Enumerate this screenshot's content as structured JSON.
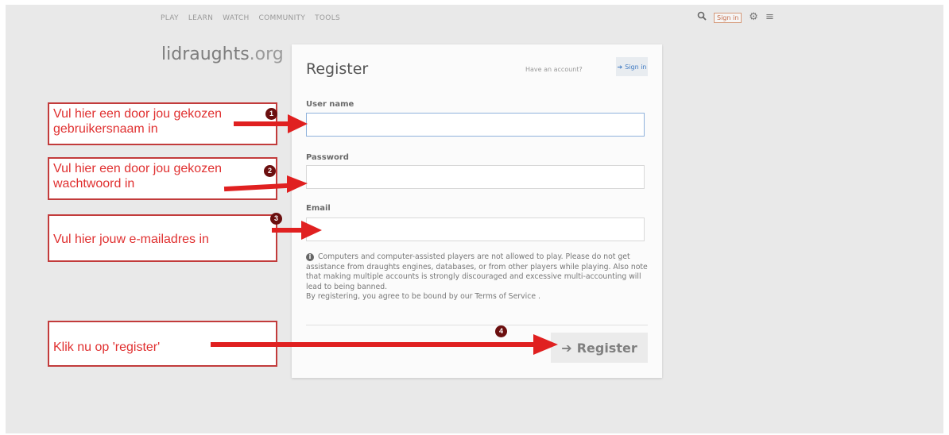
{
  "nav": {
    "items": [
      "PLAY",
      "LEARN",
      "WATCH",
      "COMMUNITY",
      "TOOLS"
    ],
    "signin_label": "Sign in"
  },
  "logo": {
    "name": "lidraughts",
    "tld": ".org"
  },
  "form": {
    "title": "Register",
    "have_account": "Have an account?",
    "signin_label": "Sign in",
    "username_label": "User name",
    "password_label": "Password",
    "email_label": "Email",
    "info_text": "Computers and computer-assisted players are not allowed to play. Please do not get assistance from draughts engines, databases, or from other players while playing. Also note that making multiple accounts is strongly discouraged and excessive multi-accounting will lead to being banned.",
    "terms_text": "By registering, you agree to be bound by our Terms of Service .",
    "register_label": "Register"
  },
  "annotations": [
    {
      "text": "Vul hier een door jou gekozen gebruikersnaam in",
      "badge": "1"
    },
    {
      "text": "Vul hier een door jou gekozen wachtwoord in",
      "badge": "2"
    },
    {
      "text": "Vul hier jouw e-mailadres in",
      "badge": "3"
    },
    {
      "text": "Klik nu op 'register'",
      "badge": "4"
    }
  ],
  "colors": {
    "annotation_red": "#e02020",
    "link_blue": "#3e79c2"
  },
  "icons": [
    "search-icon",
    "gear-icon",
    "menu-icon",
    "info-icon",
    "sign-in-icon"
  ]
}
